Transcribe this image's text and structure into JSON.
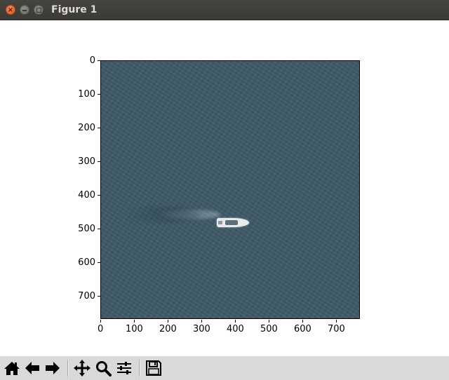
{
  "window": {
    "title": "Figure 1",
    "controls": [
      "close",
      "minimize",
      "maximize"
    ]
  },
  "figure": {
    "image_description_icon": "satellite-sea-image",
    "x_ticks": [
      "0",
      "100",
      "200",
      "300",
      "400",
      "500",
      "600",
      "700"
    ],
    "y_ticks": [
      "0",
      "100",
      "200",
      "300",
      "400",
      "500",
      "600",
      "700"
    ]
  },
  "toolbar": {
    "buttons": [
      {
        "name": "home-icon"
      },
      {
        "name": "back-arrow-icon"
      },
      {
        "name": "forward-arrow-icon"
      },
      {
        "name": "pan-icon"
      },
      {
        "name": "zoom-icon"
      },
      {
        "name": "configure-subplots-icon"
      },
      {
        "name": "save-icon"
      }
    ]
  },
  "colors": {
    "titlebar": "#3b3a36",
    "close_button": "#e05a1f",
    "toolbar_bg": "#d9d9d9",
    "sea": "#3f5a68"
  }
}
